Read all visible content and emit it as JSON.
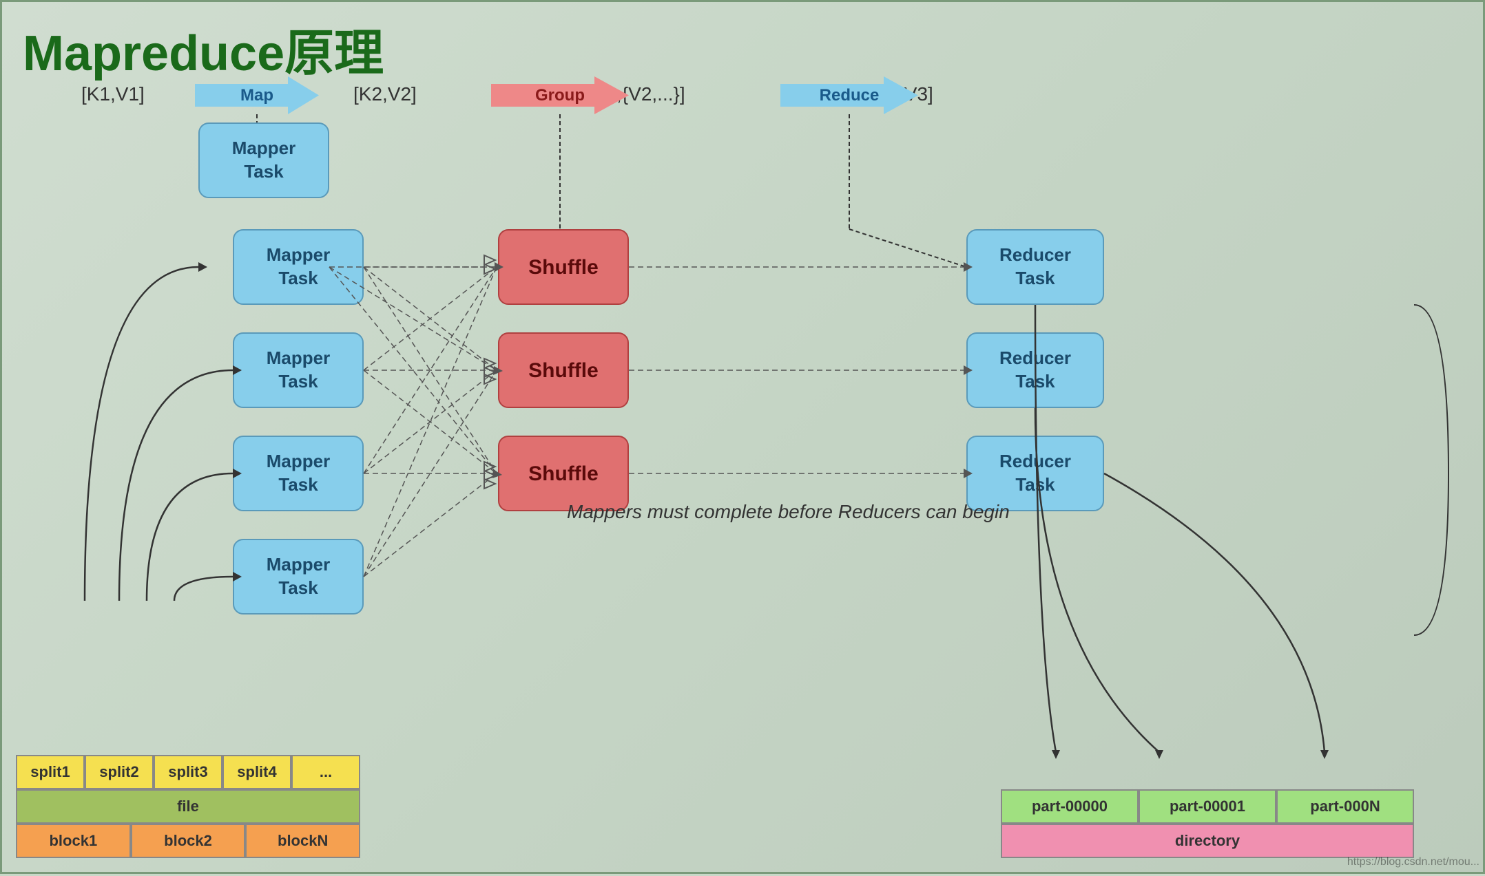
{
  "title": "Mapreduce原理",
  "flow_labels": {
    "k1v1": "[K1,V1]",
    "k2v2": "[K2,V2]",
    "k2v2group": "[K2,{V2,...}]",
    "k3v3": "[K3,V3]",
    "map_arrow": "Map",
    "group_arrow": "Group",
    "reduce_arrow": "Reduce"
  },
  "nodes": {
    "mapper1": "Mapper\nTask",
    "mapper2": "Mapper\nTask",
    "mapper3": "Mapper\nTask",
    "mapper4": "Mapper\nTask",
    "mapper5": "Mapper\nTask",
    "shuffle1": "Shuffle",
    "shuffle2": "Shuffle",
    "shuffle3": "Shuffle",
    "reducer1": "Reducer\nTask",
    "reducer2": "Reducer\nTask",
    "reducer3": "Reducer\nTask"
  },
  "bottom_left": {
    "splits": [
      "split1",
      "split2",
      "split3",
      "split4",
      "..."
    ],
    "file": "file",
    "blocks": [
      "block1",
      "block2",
      "blockN"
    ]
  },
  "bottom_right": {
    "parts": [
      "part-00000",
      "part-00001",
      "part-000N"
    ],
    "directory": "directory"
  },
  "note": "Mappers must\ncomplete before\nReducers can\nbegin",
  "watermark": "https://blog.csdn.net/mou..."
}
